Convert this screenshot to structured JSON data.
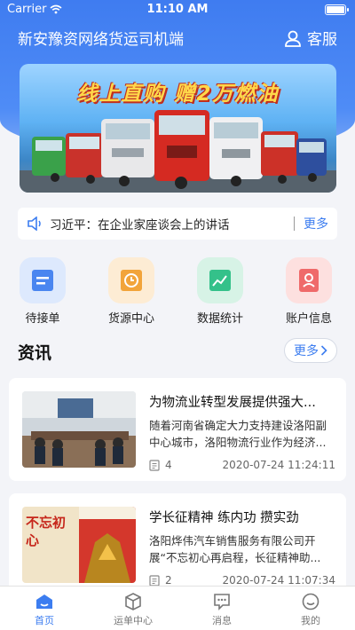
{
  "status_bar": {
    "carrier": "Carrier",
    "time": "11:10 AM"
  },
  "header": {
    "title": "新安豫资网络货运司机端",
    "service_label": "客服"
  },
  "banner": {
    "title": "线上直购 赠2万燃油"
  },
  "notice": {
    "text": "习近平：在企业家座谈会上的讲话",
    "more": "更多"
  },
  "quick_actions": [
    {
      "label": "待接单",
      "icon": "order-icon",
      "color": "#4a86f0"
    },
    {
      "label": "货源中心",
      "icon": "clock-icon",
      "color": "#f2a43a"
    },
    {
      "label": "数据统计",
      "icon": "chart-icon",
      "color": "#34c18a"
    },
    {
      "label": "账户信息",
      "icon": "account-icon",
      "color": "#ef6a6a"
    }
  ],
  "news_section": {
    "title": "资讯",
    "more": "更多"
  },
  "news": [
    {
      "title": "为物流业转型发展提供强大...",
      "desc": "随着河南省确定大力支持建设洛阳副中心城市，洛阳物流行业作为经济...",
      "count": "4",
      "date": "2020-07-24 11:24:11"
    },
    {
      "title": "学长征精神 练内功 攒实劲",
      "desc": "洛阳烨伟汽车销售服务有限公司开展“不忘初心再启程，长征精神助...",
      "count": "2",
      "date": "2020-07-24 11:07:34"
    }
  ],
  "thumb2_text": "不忘初心",
  "tabs": [
    {
      "label": "首页",
      "active": true
    },
    {
      "label": "运单中心",
      "active": false
    },
    {
      "label": "消息",
      "active": false
    },
    {
      "label": "我的",
      "active": false
    }
  ]
}
